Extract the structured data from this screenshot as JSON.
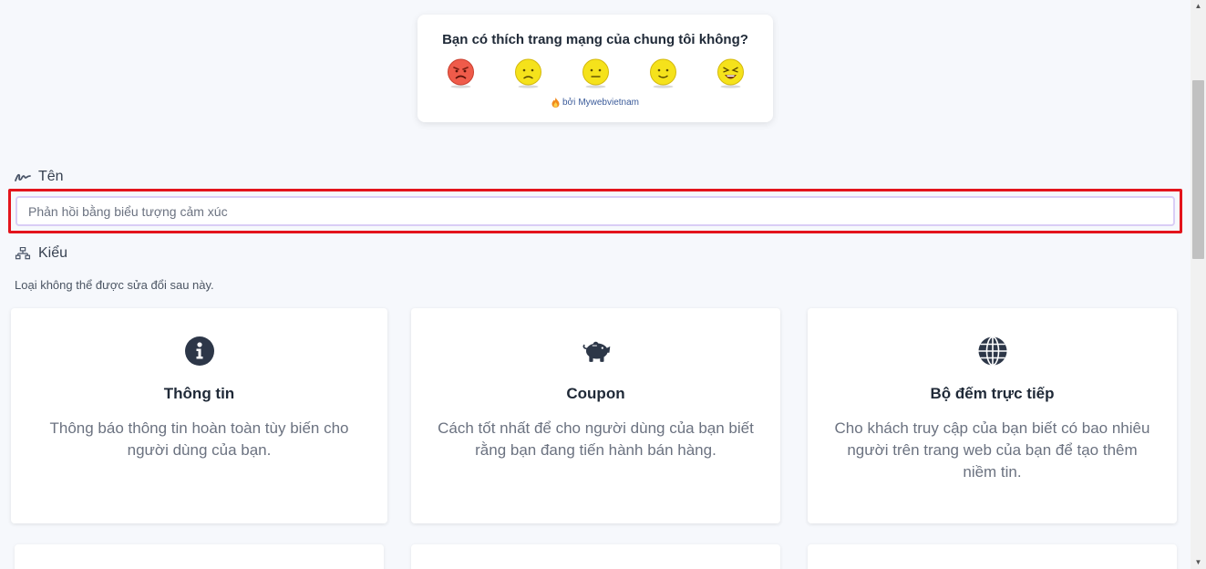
{
  "feedback": {
    "title": "Bạn có thích trang mạng của chung tôi không?",
    "emojis": [
      "angry-face-icon",
      "sad-face-icon",
      "neutral-face-icon",
      "smiling-face-icon",
      "laughing-face-icon"
    ],
    "credit_prefix": "bởi",
    "credit_link": "Mywebvietnam"
  },
  "name_field": {
    "label": "Tên",
    "placeholder": "Phản hồi bằng biểu tượng cảm xúc",
    "value": ""
  },
  "type_field": {
    "label": "Kiểu",
    "helper": "Loại không thể được sửa đổi sau này."
  },
  "cards": [
    {
      "icon": "info-circle-icon",
      "title": "Thông tin",
      "description": "Thông báo thông tin hoàn toàn tùy biến cho người dùng của bạn."
    },
    {
      "icon": "piggy-bank-icon",
      "title": "Coupon",
      "description": "Cách tốt nhất để cho người dùng của bạn biết rằng bạn đang tiến hành bán hàng."
    },
    {
      "icon": "globe-icon",
      "title": "Bộ đếm trực tiếp",
      "description": "Cho khách truy cập của bạn biết có bao nhiêu người trên trang web của bạn để tạo thêm niềm tin."
    }
  ],
  "colors": {
    "highlight": "#e3141c",
    "input_border": "#d9cdf6",
    "icon_dark": "#2d3748",
    "emoji_yellow": "#f5e21b",
    "emoji_red": "#ef5b4a"
  }
}
